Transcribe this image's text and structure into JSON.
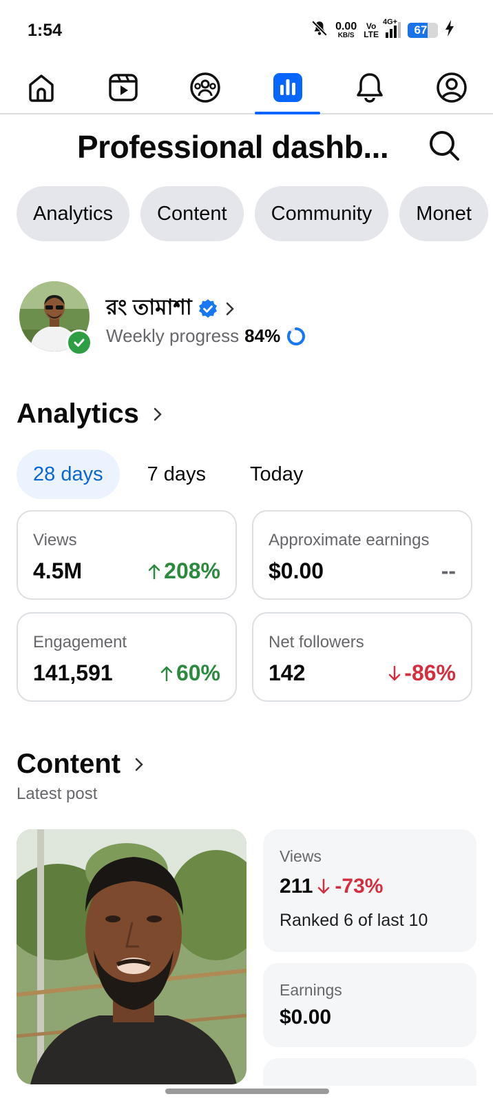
{
  "status_bar": {
    "time": "1:54",
    "netspeed_value": "0.00",
    "netspeed_unit": "KB/S",
    "volte_top": "Vo",
    "volte_bottom": "LTE",
    "signal": "4G+",
    "battery": "67",
    "battery_level": 0.67
  },
  "nav": {
    "items": [
      "home-icon",
      "video-icon",
      "groups-icon",
      "dashboard-icon",
      "notifications-icon",
      "profile-icon"
    ],
    "active": "dashboard-icon",
    "accent": "#0866ff"
  },
  "header": {
    "title": "Professional dashb..."
  },
  "tabs": [
    "Analytics",
    "Content",
    "Community",
    "Monet"
  ],
  "profile": {
    "name": "রং তামাশা",
    "progress_label": "Weekly progress",
    "progress_value": "84%",
    "progress_fraction": 0.84
  },
  "analytics": {
    "title": "Analytics",
    "ranges": [
      "28 days",
      "7 days",
      "Today"
    ],
    "active_range": "28 days",
    "metrics": [
      {
        "label": "Views",
        "value": "4.5M",
        "change": "208%",
        "direction": "up"
      },
      {
        "label": "Approximate earnings",
        "value": "$0.00",
        "change": "--",
        "direction": "neutral"
      },
      {
        "label": "Engagement",
        "value": "141,591",
        "change": "60%",
        "direction": "up"
      },
      {
        "label": "Net followers",
        "value": "142",
        "change": "-86%",
        "direction": "down"
      }
    ]
  },
  "content": {
    "title": "Content",
    "subtitle": "Latest post",
    "views_label": "Views",
    "views_value": "211",
    "views_change": "-73%",
    "views_rank": "Ranked 6 of last 10",
    "earnings_label": "Earnings",
    "earnings_value": "$0.00"
  },
  "colors": {
    "up": "#2b8a3e",
    "down": "#d32f3f",
    "verified": "#1877f2"
  }
}
